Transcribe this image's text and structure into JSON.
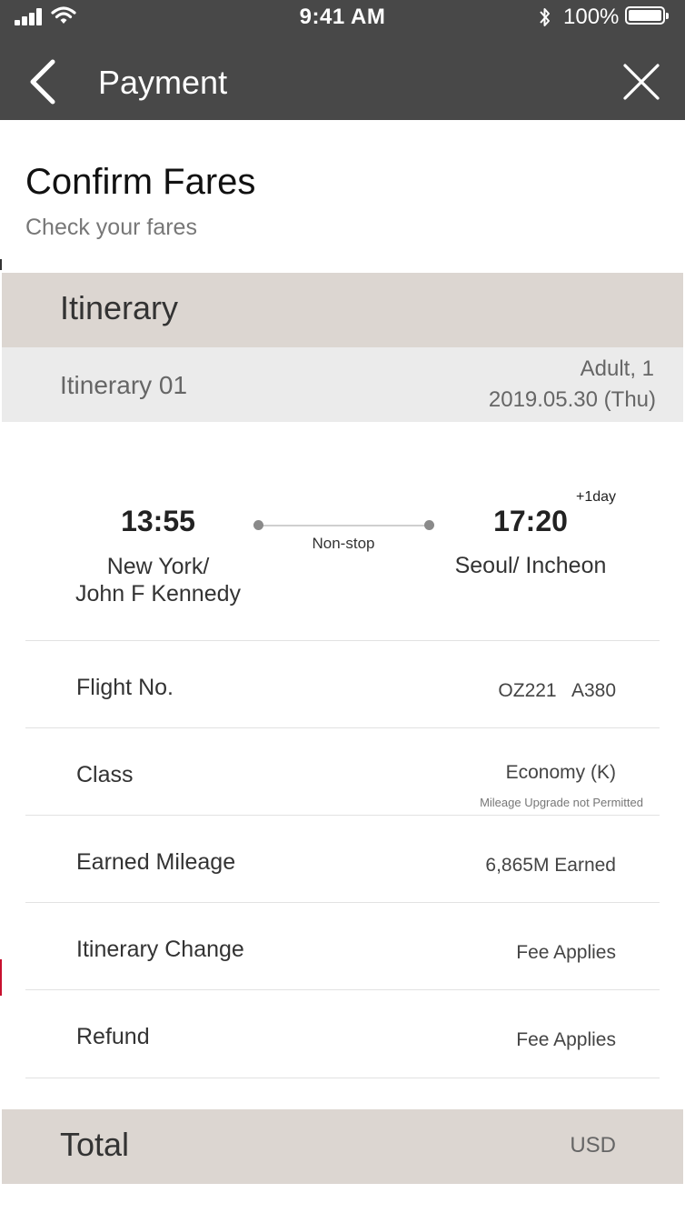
{
  "status_bar": {
    "time": "9:41 AM",
    "battery": "100%"
  },
  "header": {
    "title": "Payment"
  },
  "page": {
    "title": "Confirm Fares",
    "subtitle": "Check your fares"
  },
  "itinerary": {
    "section_title": "Itinerary",
    "label": "Itinerary 01",
    "passengers": "Adult, 1",
    "date": "2019.05.30 (Thu)",
    "departure": {
      "time": "13:55",
      "city_line1": "New York/",
      "city_line2": "John F Kennedy"
    },
    "arrival": {
      "time": "17:20",
      "day_offset": "+1day",
      "city": "Seoul/ Incheon"
    },
    "stops": "Non-stop"
  },
  "details": [
    {
      "label": "Flight No.",
      "value": "OZ221   A380"
    },
    {
      "label": "Class",
      "value": "Economy (K)",
      "note": "Mileage Upgrade not Permitted"
    },
    {
      "label": "Earned Mileage",
      "value": "6,865M Earned"
    },
    {
      "label": "Itinerary Change",
      "value": "Fee Applies"
    },
    {
      "label": "Refund",
      "value": "Fee Applies"
    }
  ],
  "total": {
    "label": "Total",
    "currency": "USD"
  },
  "colors": {
    "header_bg": "#484848",
    "section_bg": "#dcd6d1",
    "subsection_bg": "#ebebeb"
  }
}
